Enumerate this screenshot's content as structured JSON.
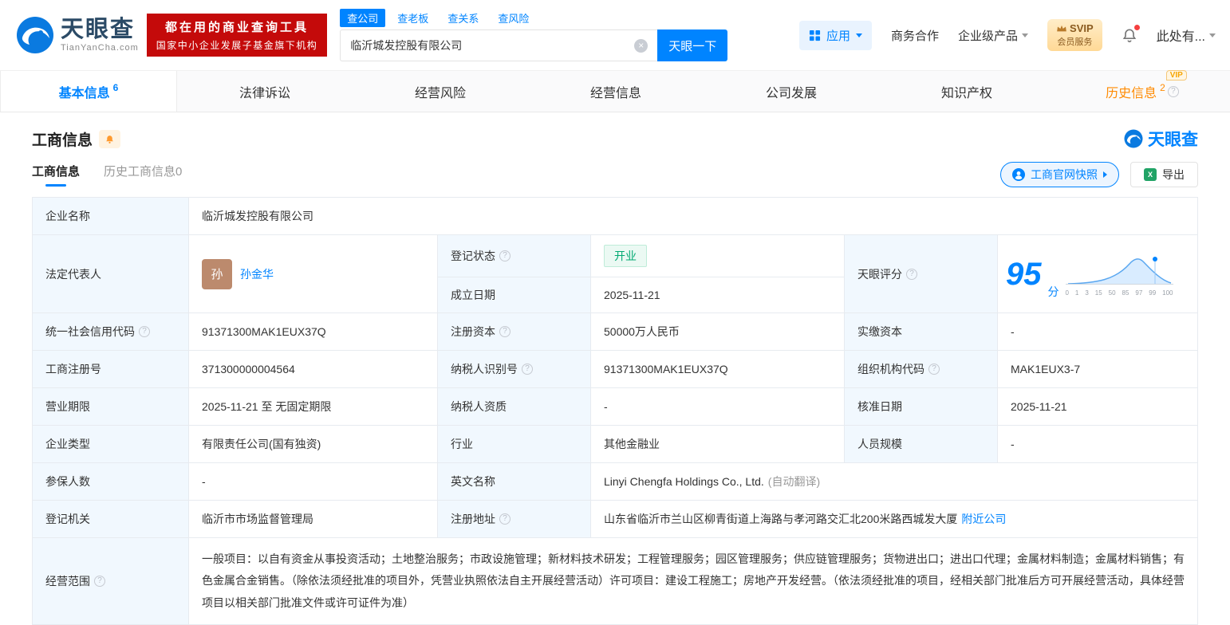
{
  "icons": {
    "help": "?",
    "clear": "×",
    "excel": "X"
  },
  "brand": {
    "name": "天眼查",
    "domain": "TianYanCha.com"
  },
  "banner": {
    "line1": "都在用的商业查询工具",
    "line2": "国家中小企业发展子基金旗下机构"
  },
  "search": {
    "tabs": [
      "查公司",
      "查老板",
      "查关系",
      "查风险"
    ],
    "value": "临沂城发控股有限公司",
    "button": "天眼一下"
  },
  "top_nav": {
    "apps": "应用",
    "cooperation": "商务合作",
    "enterprise": "企业级产品",
    "svip_line1": "SVIP",
    "svip_line2": "会员服务",
    "user": "此处有..."
  },
  "main_tabs": [
    {
      "label": "基本信息",
      "count": "6"
    },
    {
      "label": "法律诉讼"
    },
    {
      "label": "经营风险"
    },
    {
      "label": "经营信息"
    },
    {
      "label": "公司发展"
    },
    {
      "label": "知识产权"
    },
    {
      "label": "历史信息",
      "count": "2",
      "badge": "VIP"
    }
  ],
  "section": {
    "title": "工商信息",
    "brand": "天眼查"
  },
  "subtabs": {
    "current": "工商信息",
    "history": "历史工商信息0",
    "snapshot": "工商官网快照",
    "export": "导出"
  },
  "info": {
    "company_name_label": "企业名称",
    "company_name": "临沂城发控股有限公司",
    "legal_rep_label": "法定代表人",
    "legal_rep_avatar": "孙",
    "legal_rep": "孙金华",
    "reg_status_label": "登记状态",
    "reg_status": "开业",
    "est_date_label": "成立日期",
    "est_date": "2025-11-21",
    "score_label": "天眼评分",
    "score": "95",
    "score_unit": "分",
    "credit_code_label": "统一社会信用代码",
    "credit_code": "91371300MAK1EUX37Q",
    "reg_capital_label": "注册资本",
    "reg_capital": "50000万人民币",
    "paid_capital_label": "实缴资本",
    "paid_capital": "-",
    "reg_number_label": "工商注册号",
    "reg_number": "371300000004564",
    "taxpayer_id_label": "纳税人识别号",
    "taxpayer_id": "91371300MAK1EUX37Q",
    "org_code_label": "组织机构代码",
    "org_code": "MAK1EUX3-7",
    "business_term_label": "营业期限",
    "business_term": "2025-11-21 至 无固定期限",
    "taxpayer_qualification_label": "纳税人资质",
    "taxpayer_qualification": "-",
    "approval_date_label": "核准日期",
    "approval_date": "2025-11-21",
    "company_type_label": "企业类型",
    "company_type": "有限责任公司(国有独资)",
    "industry_label": "行业",
    "industry": "其他金融业",
    "staff_size_label": "人员规模",
    "staff_size": "-",
    "insured_label": "参保人数",
    "insured": "-",
    "english_name_label": "英文名称",
    "english_name": "Linyi Chengfa Holdings Co., Ltd.",
    "english_name_note": "(自动翻译)",
    "reg_authority_label": "登记机关",
    "reg_authority": "临沂市市场监督管理局",
    "address_label": "注册地址",
    "address": "山东省临沂市兰山区柳青街道上海路与孝河路交汇北200米路西城发大厦",
    "nearby_link": "附近公司",
    "business_scope_label": "经营范围",
    "business_scope": "一般项目：以自有资金从事投资活动；土地整治服务；市政设施管理；新材料技术研发；工程管理服务；园区管理服务；供应链管理服务；货物进出口；进出口代理；金属材料制造；金属材料销售；有色金属合金销售。（除依法须经批准的项目外，凭营业执照依法自主开展经营活动）许可项目：建设工程施工；房地产开发经营。（依法须经批准的项目，经相关部门批准后方可开展经营活动，具体经营项目以相关部门批准文件或许可证件为准）"
  },
  "score_chart": {
    "ticks": [
      "0",
      "1",
      "3",
      "15",
      "50",
      "85",
      "97",
      "99",
      "100"
    ]
  }
}
